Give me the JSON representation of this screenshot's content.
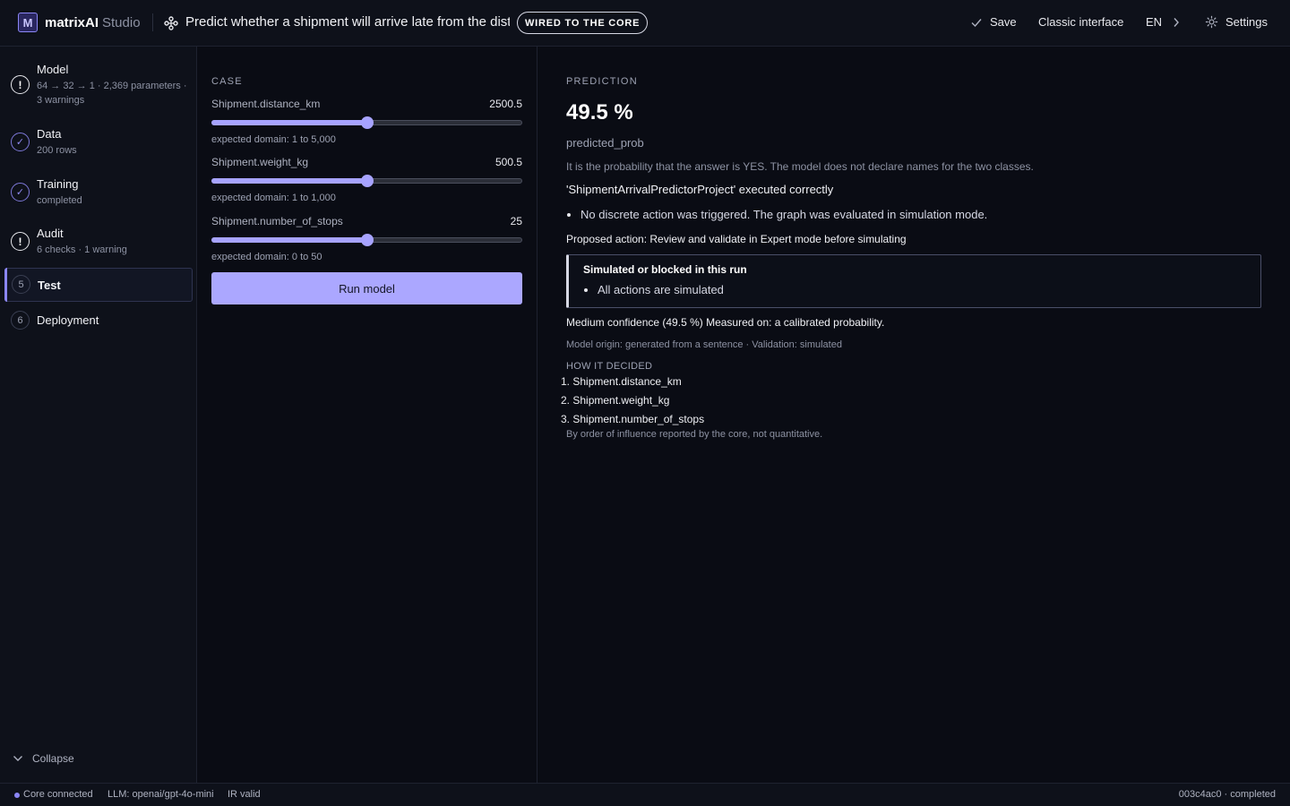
{
  "header": {
    "logo_letter": "M",
    "brand": "matrixAI",
    "brand_sub": "Studio",
    "project_title": "Predict whether a shipment will arrive late from the distanc",
    "badge": "WIRED TO THE CORE",
    "save_label": "Save",
    "classic_label": "Classic interface",
    "lang_label": "EN",
    "settings_label": "Settings"
  },
  "sidebar": {
    "steps": [
      {
        "icon": "!",
        "title": "Model",
        "sub": "64 → 32 → 1 · 2,369 parameters · 3 warnings",
        "status": "warning"
      },
      {
        "icon": "✓",
        "title": "Data",
        "sub": "200 rows",
        "status": "done"
      },
      {
        "icon": "✓",
        "title": "Training",
        "sub": "completed",
        "status": "done"
      },
      {
        "icon": "!",
        "title": "Audit",
        "sub": "6 checks · 1 warning",
        "status": "warning"
      },
      {
        "icon": "5",
        "title": "Test",
        "sub": "",
        "status": "active"
      },
      {
        "icon": "6",
        "title": "Deployment",
        "sub": "",
        "status": "pending"
      }
    ],
    "collapse_label": "Collapse"
  },
  "case": {
    "label": "CASE",
    "fields": [
      {
        "name": "Shipment.distance_km",
        "value": "2500.5",
        "fraction": 0.5,
        "domain": "expected domain: 1 to 5,000"
      },
      {
        "name": "Shipment.weight_kg",
        "value": "500.5",
        "fraction": 0.5,
        "domain": "expected domain: 1 to 1,000"
      },
      {
        "name": "Shipment.number_of_stops",
        "value": "25",
        "fraction": 0.5,
        "domain": "expected domain: 0 to 50"
      }
    ],
    "run_label": "Run model"
  },
  "prediction": {
    "label": "PREDICTION",
    "value": "49.5 %",
    "output_name": "predicted_prob",
    "explanation": "It is the probability that the answer is YES. The model does not declare names for the two classes.",
    "executed": "'ShipmentArrivalPredictorProject' executed correctly",
    "bullet": "No discrete action was triggered. The graph was evaluated in simulation mode.",
    "proposed_action": "Proposed action: Review and validate in Expert mode before simulating",
    "sim_box": {
      "title": "Simulated or blocked in this run",
      "item": "All actions are simulated"
    },
    "confidence": "Medium confidence (49.5 %) Measured on: a calibrated probability.",
    "origin": "Model origin: generated from a sentence · Validation: simulated",
    "how_label": "HOW IT DECIDED",
    "how_items": [
      "Shipment.distance_km",
      "Shipment.weight_kg",
      "Shipment.number_of_stops"
    ],
    "how_note": "By order of influence reported by the core, not quantitative."
  },
  "status": {
    "core": "Core connected",
    "llm": "LLM: openai/gpt-4o-mini",
    "ir": "IR valid",
    "run": "003c4ac0 · completed"
  },
  "colors": {
    "accent": "#aba7ff",
    "background": "#0a0c14",
    "panel": "#0e111a"
  }
}
